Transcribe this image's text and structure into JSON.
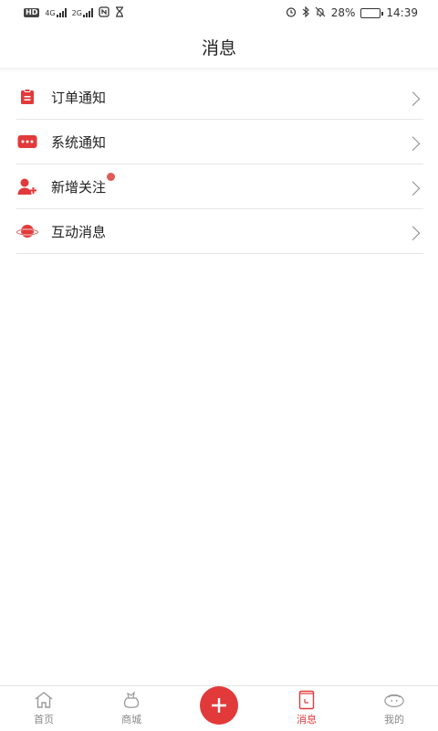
{
  "status_bar": {
    "network_hd": "HD",
    "sim1_type": "4G",
    "sim2_type": "2G",
    "battery_percent": "28%",
    "battery_level": 0.28,
    "time": "14:39"
  },
  "header": {
    "title": "消息"
  },
  "messages": {
    "items": [
      {
        "label": "订单通知",
        "icon": "clipboard-icon",
        "has_badge": false
      },
      {
        "label": "系统通知",
        "icon": "chat-dots-icon",
        "has_badge": false
      },
      {
        "label": "新增关注",
        "icon": "add-user-icon",
        "has_badge": true
      },
      {
        "label": "互动消息",
        "icon": "planet-icon",
        "has_badge": false
      }
    ]
  },
  "tab_bar": {
    "tabs": [
      {
        "label": "首页",
        "icon": "home-icon",
        "active": false
      },
      {
        "label": "商城",
        "icon": "shop-bag-icon",
        "active": false
      },
      {
        "label": "",
        "icon": "plus-icon",
        "active": false
      },
      {
        "label": "消息",
        "icon": "message-icon",
        "active": true
      },
      {
        "label": "我的",
        "icon": "profile-icon",
        "active": false
      }
    ]
  },
  "colors": {
    "accent": "#e23a3a",
    "badge": "#e05a56",
    "divider": "#e6e6e6",
    "inactive_tab": "#888888"
  }
}
